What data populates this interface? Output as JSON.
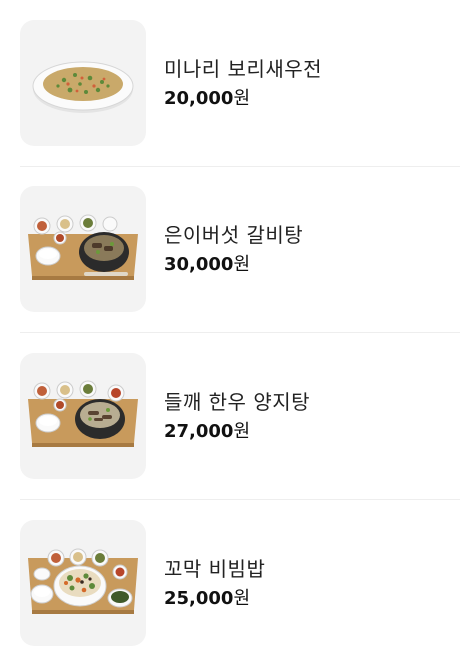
{
  "menu": {
    "currency_unit": "원",
    "items": [
      {
        "name": "미나리 보리새우전",
        "price": "20,000",
        "image_icon": "seafood-pancake-plate-icon"
      },
      {
        "name": "은이버섯 갈비탕",
        "price": "30,000",
        "image_icon": "galbitang-tray-icon"
      },
      {
        "name": "들깨 한우 양지탕",
        "price": "27,000",
        "image_icon": "yangjitang-tray-icon"
      },
      {
        "name": "꼬막 비빔밥",
        "price": "25,000",
        "image_icon": "bibimbap-tray-icon"
      }
    ]
  }
}
